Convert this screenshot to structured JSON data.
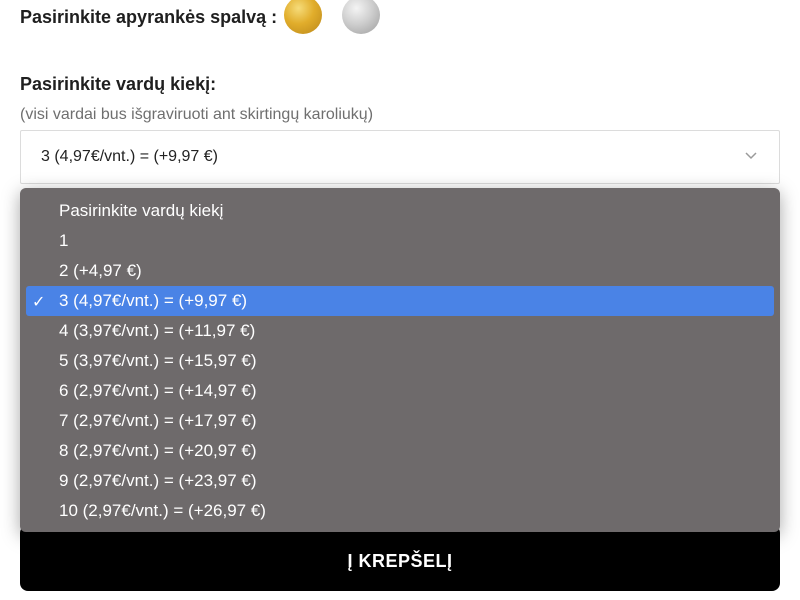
{
  "color_section": {
    "label": "Pasirinkite apyrankės spalvą :",
    "swatches": [
      {
        "name": "gold",
        "color": "#e1ad2b"
      },
      {
        "name": "silver",
        "color": "#cfcfcf"
      }
    ]
  },
  "quantity_section": {
    "title": "Pasirinkite vardų kiekį:",
    "hint": "(visi vardai bus išgraviruoti ant skirtingų karoliukų)",
    "selected_value": "3 (4,97€/vnt.) = (+9,97 €)"
  },
  "dropdown": {
    "options": [
      {
        "label": "Pasirinkite vardų kiekį",
        "selected": false
      },
      {
        "label": "1",
        "selected": false
      },
      {
        "label": "2 (+4,97 €)",
        "selected": false
      },
      {
        "label": "3 (4,97€/vnt.) = (+9,97 €)",
        "selected": true
      },
      {
        "label": "4 (3,97€/vnt.) = (+11,97 €)",
        "selected": false
      },
      {
        "label": "5 (3,97€/vnt.) = (+15,97 €)",
        "selected": false
      },
      {
        "label": "6 (2,97€/vnt.) = (+14,97 €)",
        "selected": false
      },
      {
        "label": "7 (2,97€/vnt.) = (+17,97 €)",
        "selected": false
      },
      {
        "label": "8 (2,97€/vnt.) = (+20,97 €)",
        "selected": false
      },
      {
        "label": "9 (2,97€/vnt.) = (+23,97 €)",
        "selected": false
      },
      {
        "label": "10 (2,97€/vnt.) = (+26,97 €)",
        "selected": false
      }
    ],
    "check_glyph": "✓",
    "highlight_color": "#4a83e6"
  },
  "cart_button": {
    "label": "Į KREPŠELĮ"
  },
  "icons": {
    "select_chevron": "chevron-down-icon",
    "selected_check": "checkmark-icon"
  }
}
